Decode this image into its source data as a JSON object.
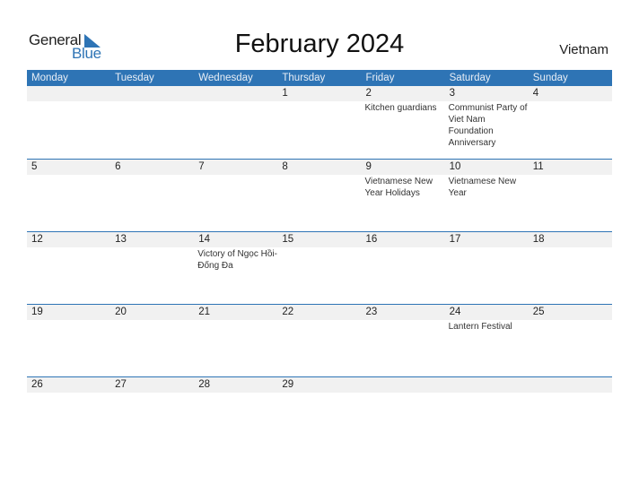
{
  "logo": {
    "word1": "General",
    "word2": "Blue"
  },
  "title": "February 2024",
  "country": "Vietnam",
  "colors": {
    "accent": "#2e74b5",
    "band": "#f1f1f1"
  },
  "weekdays": [
    "Monday",
    "Tuesday",
    "Wednesday",
    "Thursday",
    "Friday",
    "Saturday",
    "Sunday"
  ],
  "weeks": [
    {
      "days": [
        "",
        "",
        "",
        "1",
        "2",
        "3",
        "4"
      ],
      "events": [
        "",
        "",
        "",
        "",
        "Kitchen guardians",
        "Communist Party of Viet Nam Foundation Anniversary",
        ""
      ]
    },
    {
      "days": [
        "5",
        "6",
        "7",
        "8",
        "9",
        "10",
        "11"
      ],
      "events": [
        "",
        "",
        "",
        "",
        "Vietnamese New Year Holidays",
        "Vietnamese New Year",
        ""
      ]
    },
    {
      "days": [
        "12",
        "13",
        "14",
        "15",
        "16",
        "17",
        "18"
      ],
      "events": [
        "",
        "",
        "Victory of Ngọc Hồi-Đống Đa",
        "",
        "",
        "",
        ""
      ]
    },
    {
      "days": [
        "19",
        "20",
        "21",
        "22",
        "23",
        "24",
        "25"
      ],
      "events": [
        "",
        "",
        "",
        "",
        "",
        "Lantern Festival",
        ""
      ]
    },
    {
      "days": [
        "26",
        "27",
        "28",
        "29",
        "",
        "",
        ""
      ],
      "events": [
        "",
        "",
        "",
        "",
        "",
        "",
        ""
      ]
    }
  ]
}
